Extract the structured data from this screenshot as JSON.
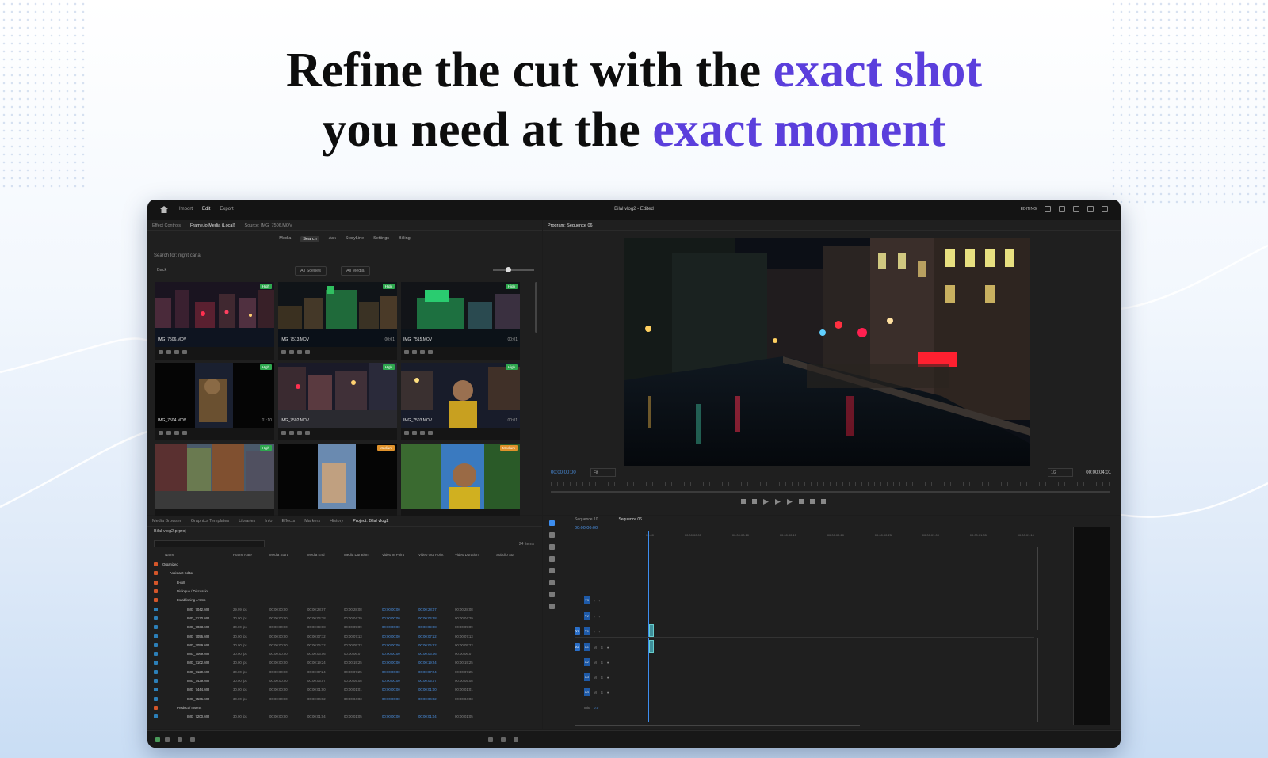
{
  "headline": {
    "line1_plain": "Refine the cut with the ",
    "line1_accent": "exact shot",
    "line2_plain": "you need at the ",
    "line2_accent": "exact moment"
  },
  "colors": {
    "accent": "#5b3fdc",
    "timecode_blue": "#4a8fe0",
    "badge_high": "#2fa84f",
    "badge_medium": "#e0922b"
  },
  "app": {
    "nav": [
      "Import",
      "Edit",
      "Export"
    ],
    "active_nav": "Edit",
    "window_title": "Bilal vlog2 - Edited",
    "workspace": "EDITING"
  },
  "media_panel": {
    "tabs": [
      "Effect Controls",
      "Frame.io Media (Local)",
      "Source: IMG_7506.MOV"
    ],
    "active_tab": "Frame.io Media (Local)",
    "tools": [
      "Media",
      "Search",
      "Ask",
      "StoryLine",
      "Settings",
      "Billing"
    ],
    "active_tool": "Search",
    "search_text": "Search for: night canal",
    "back_label": "Back",
    "scene_filter": "All Scenes",
    "media_filter": "All Media",
    "clips": [
      {
        "name": "IMG_7506.MOV",
        "badge": "High",
        "duration": ""
      },
      {
        "name": "IMG_7513.MOV",
        "badge": "High",
        "duration": "00:01"
      },
      {
        "name": "IMG_7515.MOV",
        "badge": "High",
        "duration": "00:01"
      },
      {
        "name": "IMG_7504.MOV",
        "badge": "High",
        "duration": "01:10"
      },
      {
        "name": "IMG_7502.MOV",
        "badge": "High",
        "duration": ""
      },
      {
        "name": "IMG_7503.MOV",
        "badge": "High",
        "duration": "00:01"
      },
      {
        "name": "",
        "badge": "High",
        "duration": ""
      },
      {
        "name": "",
        "badge": "Medium",
        "duration": ""
      },
      {
        "name": "",
        "badge": "Medium",
        "duration": ""
      }
    ]
  },
  "program": {
    "tab": "Program: Sequence 06",
    "timecode_left": "00:00:00:00",
    "fit": "Fit",
    "quality": "1/2",
    "timecode_right": "00:00:04:01"
  },
  "project_panel": {
    "tabs": [
      "Media Browser",
      "Graphics Templates",
      "Libraries",
      "Info",
      "Effects",
      "Markers",
      "History",
      "Project: Bilal vlog2"
    ],
    "active_tab": "Project: Bilal vlog2",
    "project_file": "Bilal vlog2.prproj",
    "item_count": "24 Items",
    "columns": [
      "Name",
      "Frame Rate",
      "Media Start",
      "Media End",
      "Media Duration",
      "Video In Point",
      "Video Out Point",
      "Video Duration",
      "Subclip Sta"
    ],
    "rows": [
      {
        "name": "Organized",
        "indent": 0,
        "type": "folder",
        "color": "#d4562a",
        "rate": "",
        "start": "",
        "end": "",
        "dur": "",
        "vin": "",
        "vout": "",
        "vdur": ""
      },
      {
        "name": "Assistant Editor",
        "indent": 1,
        "type": "folder",
        "color": "#d4562a",
        "rate": "",
        "start": "",
        "end": "",
        "dur": "",
        "vin": "",
        "vout": "",
        "vdur": ""
      },
      {
        "name": "B-roll",
        "indent": 2,
        "type": "folder",
        "color": "#d4562a",
        "rate": "",
        "start": "",
        "end": "",
        "dur": "",
        "vin": "",
        "vout": "",
        "vdur": ""
      },
      {
        "name": "Dialogue / Discussio",
        "indent": 2,
        "type": "folder",
        "color": "#d4562a",
        "rate": "",
        "start": "",
        "end": "",
        "dur": "",
        "vin": "",
        "vout": "",
        "vdur": ""
      },
      {
        "name": "Establishing / Atmo",
        "indent": 2,
        "type": "folder",
        "color": "#d4562a",
        "rate": "",
        "start": "",
        "end": "",
        "dur": "",
        "vin": "",
        "vout": "",
        "vdur": ""
      },
      {
        "name": "IMG_7042.MO",
        "indent": 3,
        "type": "clip",
        "color": "#2c7fb8",
        "rate": "29.99 fps",
        "start": "00:00:00:00",
        "end": "00:00:28:07",
        "dur": "00:00:28:08",
        "vin": "00:00:00:00",
        "vout": "00:00:28:07",
        "vdur": "00:00:28:08"
      },
      {
        "name": "IMG_7130.MO",
        "indent": 3,
        "type": "clip",
        "color": "#2c7fb8",
        "rate": "30.00 fps",
        "start": "00:00:00:00",
        "end": "00:00:04:28",
        "dur": "00:00:04:29",
        "vin": "00:00:00:00",
        "vout": "00:00:04:28",
        "vdur": "00:00:04:29"
      },
      {
        "name": "IMG_7033.MO",
        "indent": 3,
        "type": "clip",
        "color": "#2c7fb8",
        "rate": "30.00 fps",
        "start": "00:00:00:00",
        "end": "00:00:09:08",
        "dur": "00:00:09:09",
        "vin": "00:00:00:00",
        "vout": "00:00:09:08",
        "vdur": "00:00:09:09"
      },
      {
        "name": "IMG_7056.MO",
        "indent": 3,
        "type": "clip",
        "color": "#2c7fb8",
        "rate": "30.00 fps",
        "start": "00:00:00:00",
        "end": "00:00:07:12",
        "dur": "00:00:07:13",
        "vin": "00:00:00:00",
        "vout": "00:00:07:12",
        "vdur": "00:00:07:13"
      },
      {
        "name": "IMG_7059.MO",
        "indent": 3,
        "type": "clip",
        "color": "#2c7fb8",
        "rate": "30.00 fps",
        "start": "00:00:00:00",
        "end": "00:00:05:22",
        "dur": "00:00:05:23",
        "vin": "00:00:00:00",
        "vout": "00:00:05:22",
        "vdur": "00:00:05:23"
      },
      {
        "name": "IMG_7069.MO",
        "indent": 3,
        "type": "clip",
        "color": "#2c7fb8",
        "rate": "30.00 fps",
        "start": "00:00:00:00",
        "end": "00:00:06:06",
        "dur": "00:00:06:07",
        "vin": "00:00:00:00",
        "vout": "00:00:06:06",
        "vdur": "00:00:06:07"
      },
      {
        "name": "IMG_7102.MO",
        "indent": 3,
        "type": "clip",
        "color": "#2c7fb8",
        "rate": "30.00 fps",
        "start": "00:00:00:00",
        "end": "00:00:19:24",
        "dur": "00:00:19:25",
        "vin": "00:00:00:00",
        "vout": "00:00:19:24",
        "vdur": "00:00:19:25"
      },
      {
        "name": "IMG_7120.MO",
        "indent": 3,
        "type": "clip",
        "color": "#2c7fb8",
        "rate": "30.00 fps",
        "start": "00:00:00:00",
        "end": "00:00:07:24",
        "dur": "00:00:07:25",
        "vin": "00:00:00:00",
        "vout": "00:00:07:24",
        "vdur": "00:00:07:25"
      },
      {
        "name": "IMG_7439.MO",
        "indent": 3,
        "type": "clip",
        "color": "#2c7fb8",
        "rate": "30.00 fps",
        "start": "00:00:00:00",
        "end": "00:00:05:07",
        "dur": "00:00:05:08",
        "vin": "00:00:00:00",
        "vout": "00:00:05:07",
        "vdur": "00:00:05:08"
      },
      {
        "name": "IMG_7444.MO",
        "indent": 3,
        "type": "clip",
        "color": "#2c7fb8",
        "rate": "30.00 fps",
        "start": "00:00:00:00",
        "end": "00:00:01:00",
        "dur": "00:00:01:01",
        "vin": "00:00:00:00",
        "vout": "00:00:01:00",
        "vdur": "00:00:01:01"
      },
      {
        "name": "IMG_7506.MO",
        "indent": 3,
        "type": "clip",
        "color": "#2c7fb8",
        "rate": "30.00 fps",
        "start": "00:00:00:00",
        "end": "00:00:04:02",
        "dur": "00:00:04:03",
        "vin": "00:00:00:00",
        "vout": "00:00:04:02",
        "vdur": "00:00:04:03"
      },
      {
        "name": "Product / Inserts",
        "indent": 2,
        "type": "folder",
        "color": "#d4562a",
        "rate": "",
        "start": "",
        "end": "",
        "dur": "",
        "vin": "",
        "vout": "",
        "vdur": ""
      },
      {
        "name": "IMG_7200.MO",
        "indent": 3,
        "type": "clip",
        "color": "#2c7fb8",
        "rate": "30.00 fps",
        "start": "00:00:00:00",
        "end": "00:00:01:04",
        "dur": "00:00:01:05",
        "vin": "00:00:00:00",
        "vout": "00:00:01:04",
        "vdur": "00:00:01:05"
      }
    ]
  },
  "timeline": {
    "tabs": [
      "Sequence 10",
      "Sequence 06"
    ],
    "active_tab": "Sequence 06",
    "timecode": "00:00:00:00",
    "ruler": [
      "00:00",
      "00:00:00:05",
      "00:00:00:10",
      "00:00:00:15",
      "00:00:00:20",
      "00:00:00:25",
      "00:00:01:00",
      "00:00:01:05",
      "00:00:01:10"
    ],
    "video_tracks": [
      "V3",
      "V2",
      "V1"
    ],
    "audio_tracks": [
      "A1",
      "A2",
      "A3",
      "A4"
    ],
    "mix_label": "Mix",
    "mix_value": "0.0"
  }
}
